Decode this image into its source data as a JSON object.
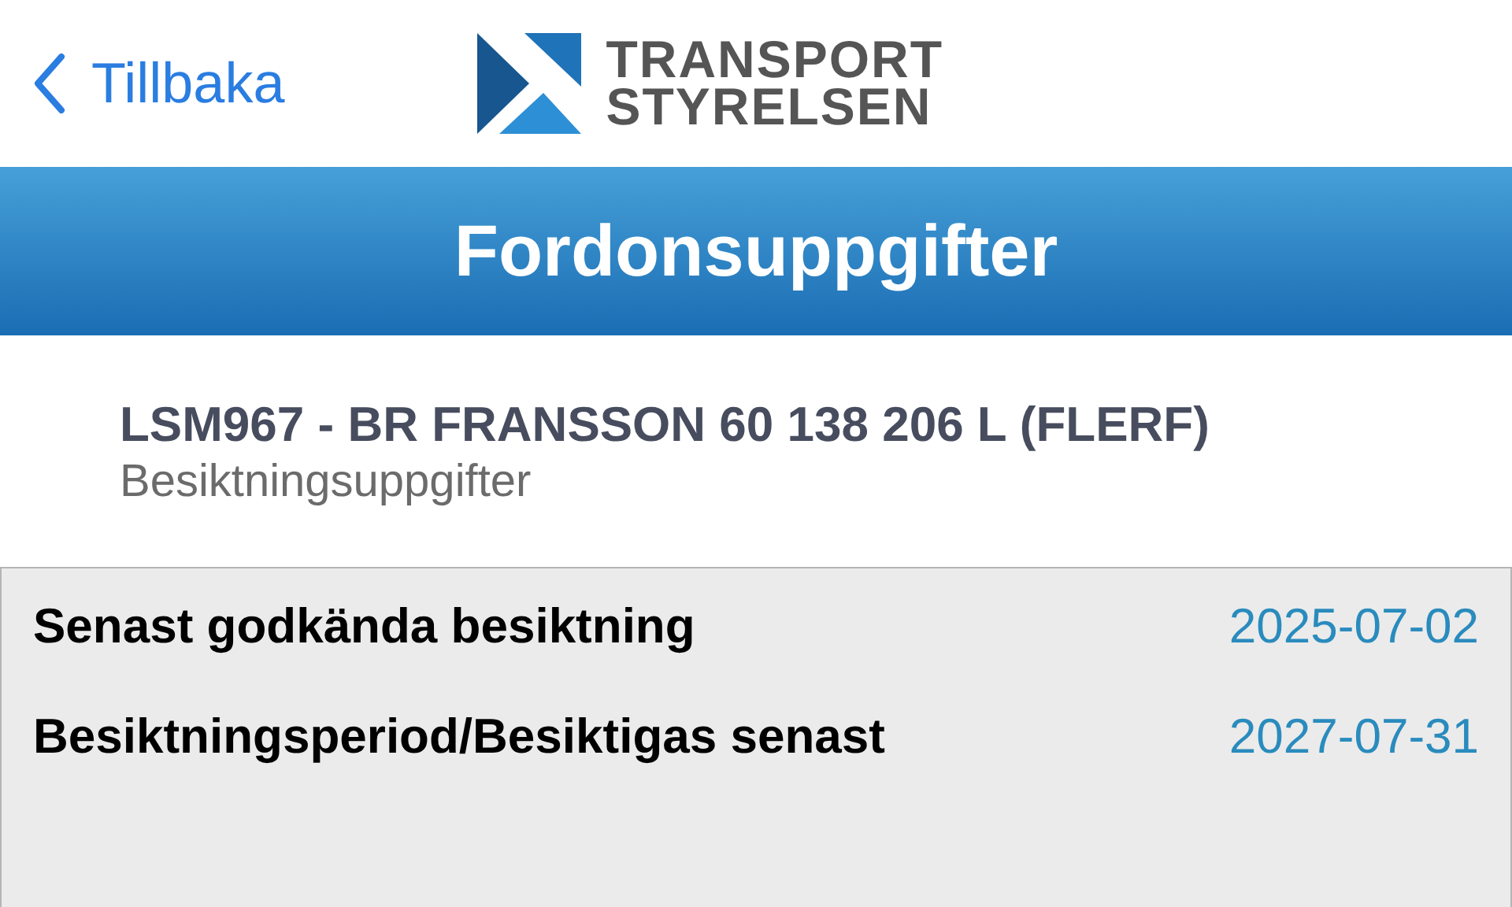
{
  "nav": {
    "back_label": "Tillbaka",
    "logo_lines": [
      "TRANSPORT",
      "STYRELSEN"
    ]
  },
  "header": {
    "title": "Fordonsuppgifter"
  },
  "vehicle": {
    "title": "LSM967 - BR FRANSSON 60 138 206 L (FLERF)",
    "subtitle": "Besiktningsuppgifter"
  },
  "rows": [
    {
      "label": "Senast godkända besiktning",
      "value": "2025-07-02"
    },
    {
      "label": "Besiktningsperiod/Besiktigas senast",
      "value": "2027-07-31"
    }
  ]
}
